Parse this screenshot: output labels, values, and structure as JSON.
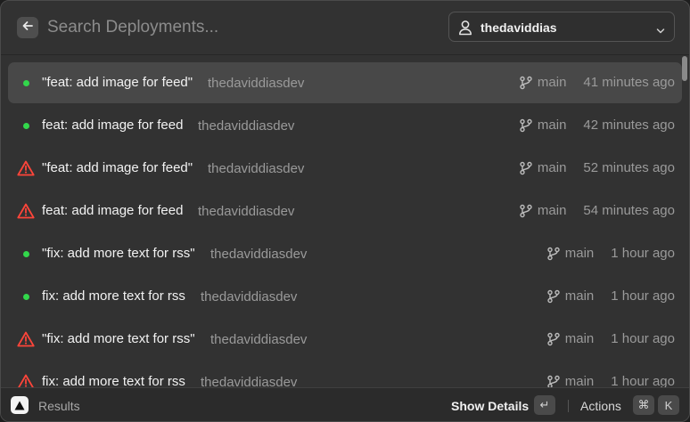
{
  "search": {
    "placeholder": "Search Deployments..."
  },
  "account": {
    "label": "thedaviddias",
    "icon": "user-icon"
  },
  "colors": {
    "success": "#32d74b",
    "error": "#ff453a",
    "selected_row": "#484848"
  },
  "deployments": [
    {
      "status": "success",
      "title": "\"feat: add image for feed\"",
      "author": "thedaviddiasdev",
      "branch": "main",
      "time": "41 minutes ago"
    },
    {
      "status": "success",
      "title": "feat: add image for feed",
      "author": "thedaviddiasdev",
      "branch": "main",
      "time": "42 minutes ago"
    },
    {
      "status": "error",
      "title": "\"feat: add image for feed\"",
      "author": "thedaviddiasdev",
      "branch": "main",
      "time": "52 minutes ago"
    },
    {
      "status": "error",
      "title": "feat: add image for feed",
      "author": "thedaviddiasdev",
      "branch": "main",
      "time": "54 minutes ago"
    },
    {
      "status": "success",
      "title": "\"fix: add more text for rss\"",
      "author": "thedaviddiasdev",
      "branch": "main",
      "time": "1 hour ago"
    },
    {
      "status": "success",
      "title": "fix: add more text for rss",
      "author": "thedaviddiasdev",
      "branch": "main",
      "time": "1 hour ago"
    },
    {
      "status": "error",
      "title": "\"fix: add more text for rss\"",
      "author": "thedaviddiasdev",
      "branch": "main",
      "time": "1 hour ago"
    },
    {
      "status": "error",
      "title": "fix: add more text for rss",
      "author": "thedaviddiasdev",
      "branch": "main",
      "time": "1 hour ago"
    }
  ],
  "footer": {
    "results_label": "Results",
    "show_details_label": "Show Details",
    "enter_key": "↵",
    "actions_label": "Actions",
    "cmd_key": "⌘",
    "k_key": "K"
  }
}
